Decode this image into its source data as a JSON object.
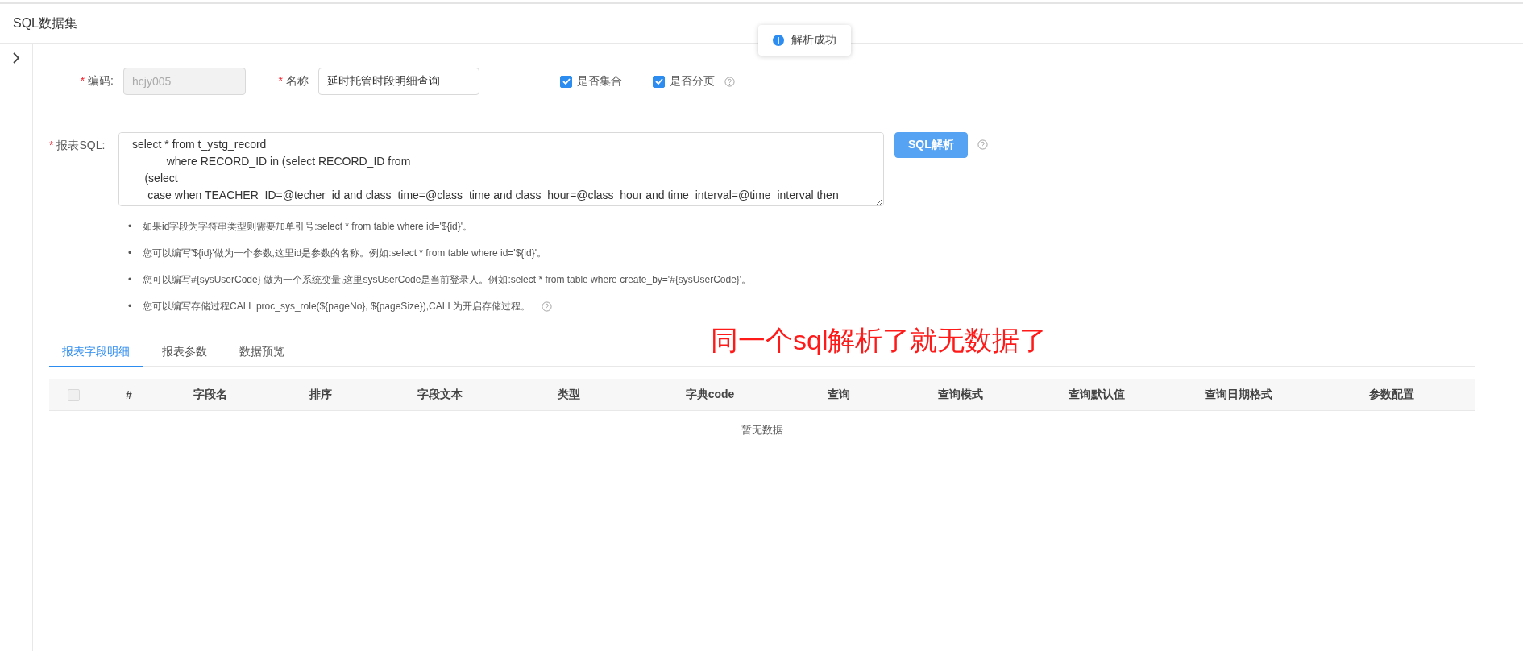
{
  "page_title": "SQL数据集",
  "toast": {
    "text": "解析成功"
  },
  "form": {
    "code": {
      "mark": "*",
      "label": "编码:",
      "value": "hcjy005",
      "disabled": true
    },
    "name": {
      "mark": "*",
      "label": "名称",
      "value": "延时托管时段明细查询"
    },
    "checkboxes": [
      {
        "label": "是否集合",
        "checked": true,
        "help": false
      },
      {
        "label": "是否分页",
        "checked": true,
        "help": true
      }
    ],
    "sql": {
      "mark": "*",
      "label": "报表SQL:",
      "lines": [
        " select * from t_ystg_record",
        "            where RECORD_ID in (select RECORD_ID from",
        "     (select",
        "      case when TEACHER_ID=@techer_id and class_time=@class_time and class_hour=@class_hour and time_interval=@time_interval then"
      ]
    },
    "parse_button": "SQL解析"
  },
  "hints": [
    {
      "bullet": "•",
      "text": "如果id字段为字符串类型则需要加单引号:select * from table where id='${id}'。",
      "help": false
    },
    {
      "bullet": "•",
      "text": "您可以编写'${id}'做为一个参数,这里id是参数的名称。例如:select * from table where id='${id}'。",
      "help": false
    },
    {
      "bullet": "•",
      "text": "您可以编写#{sysUserCode} 做为一个系统变量,这里sysUserCode是当前登录人。例如:select * from table where create_by='#{sysUserCode}'。",
      "help": false
    },
    {
      "bullet": "•",
      "text": "您可以编写存储过程CALL proc_sys_role(${pageNo}, ${pageSize}),CALL为开启存储过程。",
      "help": true
    }
  ],
  "tabs": [
    {
      "label": "报表字段明细",
      "selected": true
    },
    {
      "label": "报表参数",
      "selected": false
    },
    {
      "label": "数据预览",
      "selected": false
    }
  ],
  "annotation": "同一个sql解析了就无数据了",
  "table": {
    "select_all_checked": false,
    "columns": [
      "#",
      "字段名",
      "排序",
      "字段文本",
      "类型",
      "字典code",
      "查询",
      "查询模式",
      "查询默认值",
      "查询日期格式",
      "参数配置"
    ],
    "empty_text": "暂无数据"
  }
}
